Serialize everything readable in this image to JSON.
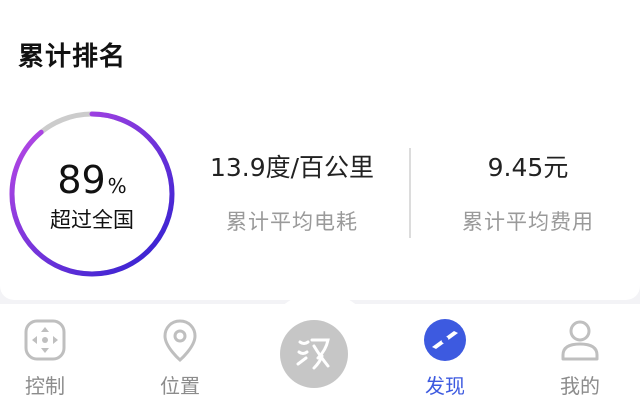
{
  "card": {
    "title": "累计排名"
  },
  "ranking": {
    "percent_value": "89",
    "percent_unit": "%",
    "percent_fraction": 0.89,
    "caption": "超过全国",
    "ring_colors": {
      "start": "#2a1fd0",
      "end": "#c14ae6",
      "track": "#cccccc"
    }
  },
  "stats": {
    "consumption_value": "13.9度/百公里",
    "consumption_label": "累计平均电耗",
    "cost_value": "9.45元",
    "cost_label": "累计平均费用"
  },
  "tabbar": {
    "active_color": "#3d5ae0",
    "inactive_color": "#8c8c8c",
    "tabs": [
      {
        "label": "控制",
        "icon": "control-pad-icon",
        "active": false
      },
      {
        "label": "位置",
        "icon": "location-pin-icon",
        "active": false
      },
      {
        "label": "",
        "icon": "brand-logo-icon",
        "active": false
      },
      {
        "label": "发现",
        "icon": "compass-icon",
        "active": true
      },
      {
        "label": "我的",
        "icon": "user-icon",
        "active": false
      }
    ]
  }
}
